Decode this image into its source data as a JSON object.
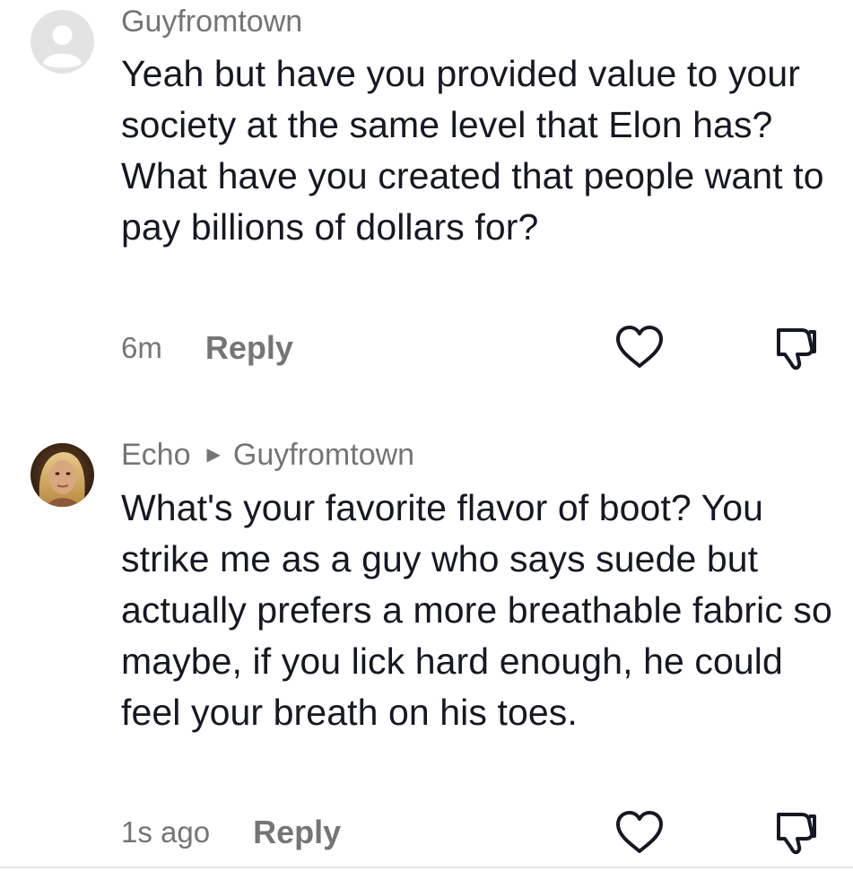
{
  "comments": [
    {
      "username": "Guyfromtown",
      "avatar_icon": "default-user-avatar-icon",
      "text": "Yeah but have you provided value to your society at the same level that Elon has? What have you created that people want to pay billions of dollars for?",
      "timestamp": "6m",
      "reply_label": "Reply",
      "like_icon": "heart-outline-icon",
      "dislike_icon": "thumbs-down-icon"
    },
    {
      "username": "Echo",
      "reply_to": "Guyfromtown",
      "avatar_icon": "user-photo-avatar",
      "text": "What's your favorite flavor of boot? You strike me as a guy who says suede but actually prefers a more breathable fabric so maybe, if you lick hard enough, he could feel your breath on his toes.",
      "timestamp": "1s ago",
      "reply_label": "Reply",
      "like_icon": "heart-outline-icon",
      "dislike_icon": "thumbs-down-icon"
    }
  ],
  "colors": {
    "text_primary": "#161823",
    "text_secondary": "#757575",
    "icon_stroke": "#161823",
    "avatar_default_bg": "#e3e3e3"
  }
}
